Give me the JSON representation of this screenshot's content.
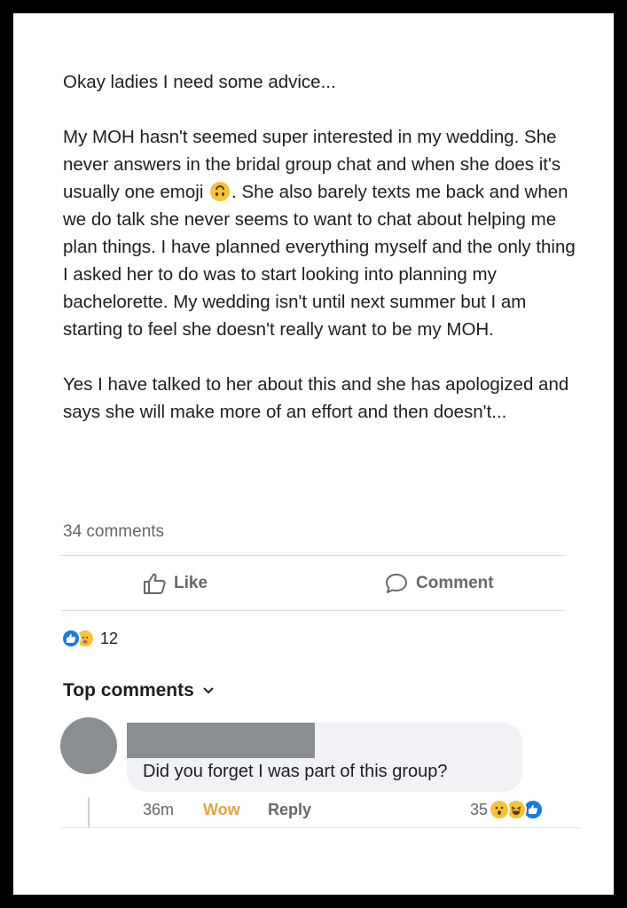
{
  "post": {
    "paragraphs": [
      "Okay ladies I need some advice...",
      "My MOH hasn't seemed super interested in my wedding. She never answers in the bridal group chat and when she does it's usually one emoji",
      ". She also barely texts me back and when we do talk she never seems to want to chat about helping me plan things. I have planned everything myself and the only thing I asked her to do was to start looking into planning my bachelorette. My wedding isn't until next summer but I am starting to feel she doesn't really want to be my MOH.",
      "Yes I have talked to her about this and she has apologized and says she will make more of an effort and then doesn't..."
    ],
    "inline_emoji": "upside-down-face-emoji",
    "comment_count": "34 comments",
    "reaction_count": "12"
  },
  "actions": {
    "like_label": "Like",
    "comment_label": "Comment"
  },
  "comments_section": {
    "heading": "Top comments",
    "comments": [
      {
        "author_redacted": true,
        "text": "Did you forget I was part of this group?",
        "time": "36m",
        "reaction_action": "Wow",
        "reply_label": "Reply",
        "reaction_count": "35"
      }
    ]
  },
  "colors": {
    "like_blue": "#1877f2",
    "wow_orange": "#e8a33d",
    "muted_text": "#65676b",
    "bubble_bg": "#f0f2f5",
    "redaction_gray": "#8a8d91"
  }
}
